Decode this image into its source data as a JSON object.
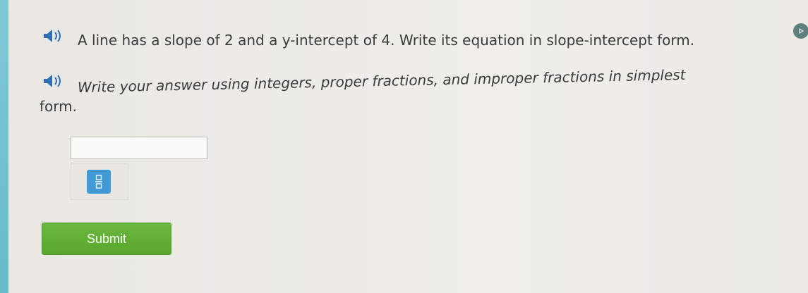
{
  "question": {
    "prompt": "A line has a slope of 2 and a y-intercept of 4. Write its equation in slope-intercept form.",
    "instructions_line1": "Write your answer using integers, proper fractions, and improper fractions in simplest",
    "instructions_line2": "form."
  },
  "answer": {
    "value": "",
    "placeholder": ""
  },
  "keypad": {
    "fraction_icon": "fraction-icon"
  },
  "submit": {
    "label": "Submit"
  },
  "colors": {
    "submit_green": "#5aa72f",
    "keypad_blue": "#3f9ad6",
    "speaker_blue": "#2f6fb1",
    "accent_teal": "#66bccb"
  }
}
